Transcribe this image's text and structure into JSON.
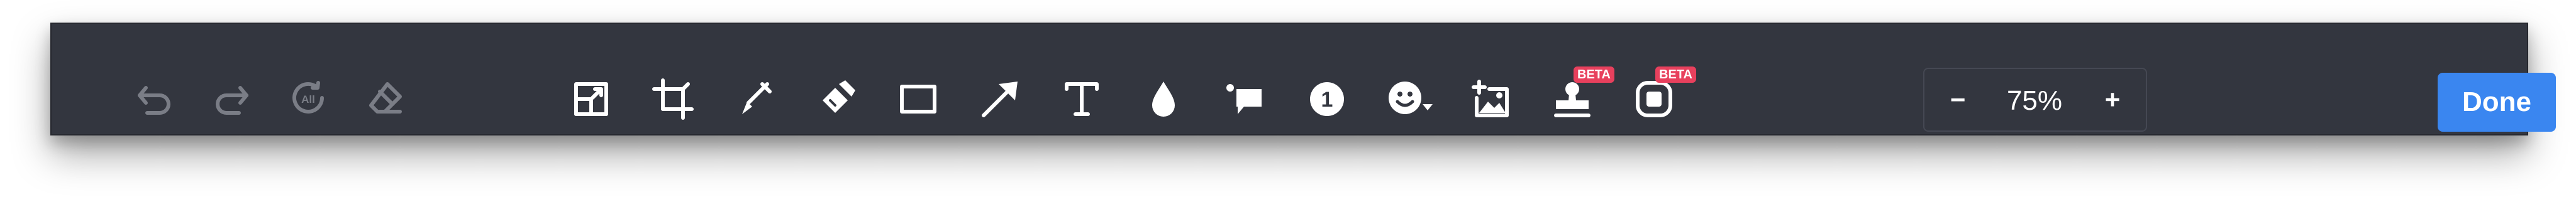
{
  "toolbar": {
    "history_icons": [
      "undo-icon",
      "redo-icon",
      "reset-all-icon",
      "eraser-icon"
    ],
    "reset_all_label": "All",
    "tool_icons": [
      "resize-icon",
      "crop-icon",
      "pen-icon",
      "highlighter-icon",
      "rectangle-icon",
      "arrow-icon",
      "text-icon",
      "blur-drop-icon",
      "callout-icon",
      "step-number-icon",
      "emoji-icon",
      "add-image-icon",
      "stamp-icon",
      "frame-icon"
    ],
    "step_number_label": "1",
    "badges": {
      "stamp": "BETA",
      "frame": "BETA"
    },
    "zoom": {
      "minus": "−",
      "value": "75%",
      "plus": "+"
    },
    "done_label": "Done"
  }
}
